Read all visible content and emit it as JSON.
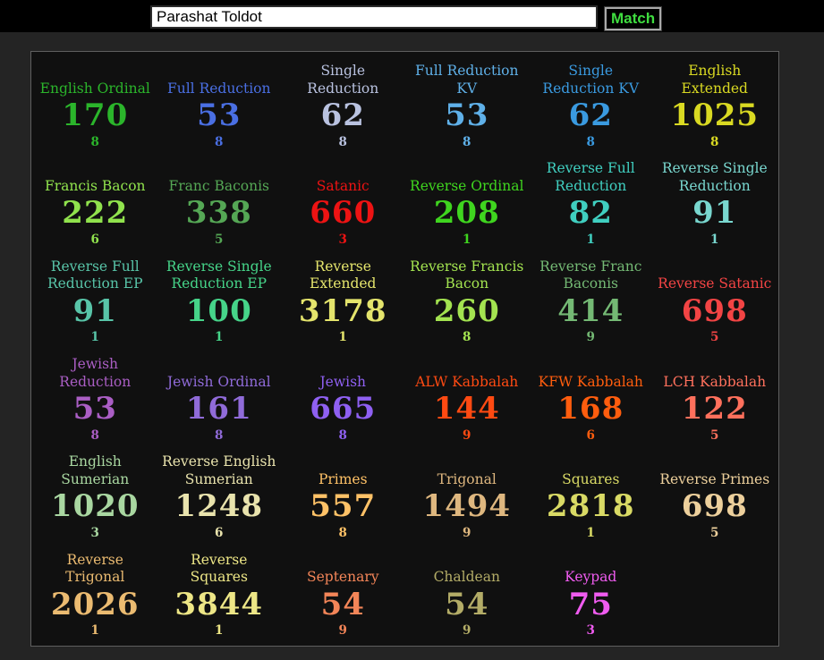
{
  "search": {
    "query": "Parashat Toldot",
    "match_label": "Match",
    "match_color": "#3fdc3f"
  },
  "colors": {
    "page_bg": "#242424",
    "topbar_bg": "#000000",
    "panel_bg": "#101010",
    "panel_border": "#5f5f5f"
  },
  "ciphers": [
    {
      "name": "English Ordinal",
      "value": "170",
      "reduced": "8",
      "color": "#2bb52b"
    },
    {
      "name": "Full Reduction",
      "value": "53",
      "reduced": "8",
      "color": "#4a6fe3"
    },
    {
      "name": "Single\nReduction",
      "value": "62",
      "reduced": "8",
      "color": "#b9c2e0"
    },
    {
      "name": "Full Reduction\nKV",
      "value": "53",
      "reduced": "8",
      "color": "#5fb0e8"
    },
    {
      "name": "Single\nReduction KV",
      "value": "62",
      "reduced": "8",
      "color": "#3a9ae0"
    },
    {
      "name": "English\nExtended",
      "value": "1025",
      "reduced": "8",
      "color": "#d9d922"
    },
    {
      "name": "Francis Bacon",
      "value": "222",
      "reduced": "6",
      "color": "#90e24d"
    },
    {
      "name": "Franc Baconis",
      "value": "338",
      "reduced": "5",
      "color": "#55a755"
    },
    {
      "name": "Satanic",
      "value": "660",
      "reduced": "3",
      "color": "#ed1313"
    },
    {
      "name": "Reverse Ordinal",
      "value": "208",
      "reduced": "1",
      "color": "#3fd51f"
    },
    {
      "name": "Reverse Full\nReduction",
      "value": "82",
      "reduced": "1",
      "color": "#40cfc0"
    },
    {
      "name": "Reverse Single\nReduction",
      "value": "91",
      "reduced": "1",
      "color": "#79d7cf"
    },
    {
      "name": "Reverse Full\nReduction EP",
      "value": "91",
      "reduced": "1",
      "color": "#58c4a8"
    },
    {
      "name": "Reverse Single\nReduction EP",
      "value": "100",
      "reduced": "1",
      "color": "#46d489"
    },
    {
      "name": "Reverse\nExtended",
      "value": "3178",
      "reduced": "1",
      "color": "#e4e46c"
    },
    {
      "name": "Reverse Francis\nBacon",
      "value": "260",
      "reduced": "8",
      "color": "#a3e350"
    },
    {
      "name": "Reverse Franc\nBaconis",
      "value": "414",
      "reduced": "9",
      "color": "#74b974"
    },
    {
      "name": "Reverse Satanic",
      "value": "698",
      "reduced": "5",
      "color": "#f24444"
    },
    {
      "name": "Jewish\nReduction",
      "value": "53",
      "reduced": "8",
      "color": "#aa5ec4"
    },
    {
      "name": "Jewish Ordinal",
      "value": "161",
      "reduced": "8",
      "color": "#906bd9"
    },
    {
      "name": "Jewish",
      "value": "665",
      "reduced": "8",
      "color": "#8f60f2"
    },
    {
      "name": "ALW Kabbalah",
      "value": "144",
      "reduced": "9",
      "color": "#ff4a12"
    },
    {
      "name": "KFW Kabbalah",
      "value": "168",
      "reduced": "6",
      "color": "#ff5d0e"
    },
    {
      "name": "LCH Kabbalah",
      "value": "122",
      "reduced": "5",
      "color": "#ff705c"
    },
    {
      "name": "English\nSumerian",
      "value": "1020",
      "reduced": "3",
      "color": "#a9d7a1"
    },
    {
      "name": "Reverse English\nSumerian",
      "value": "1248",
      "reduced": "6",
      "color": "#e9e3ad"
    },
    {
      "name": "Primes",
      "value": "557",
      "reduced": "8",
      "color": "#ffc267"
    },
    {
      "name": "Trigonal",
      "value": "1494",
      "reduced": "9",
      "color": "#deb77f"
    },
    {
      "name": "Squares",
      "value": "2818",
      "reduced": "1",
      "color": "#d9da65"
    },
    {
      "name": "Reverse Primes",
      "value": "698",
      "reduced": "5",
      "color": "#edd09c"
    },
    {
      "name": "Reverse\nTrigonal",
      "value": "2026",
      "reduced": "1",
      "color": "#ebbb71"
    },
    {
      "name": "Reverse\nSquares",
      "value": "3844",
      "reduced": "1",
      "color": "#ede686"
    },
    {
      "name": "Septenary",
      "value": "54",
      "reduced": "9",
      "color": "#f38558"
    },
    {
      "name": "Chaldean",
      "value": "54",
      "reduced": "9",
      "color": "#b3ac67"
    },
    {
      "name": "Keypad",
      "value": "75",
      "reduced": "3",
      "color": "#f05cf0"
    }
  ]
}
